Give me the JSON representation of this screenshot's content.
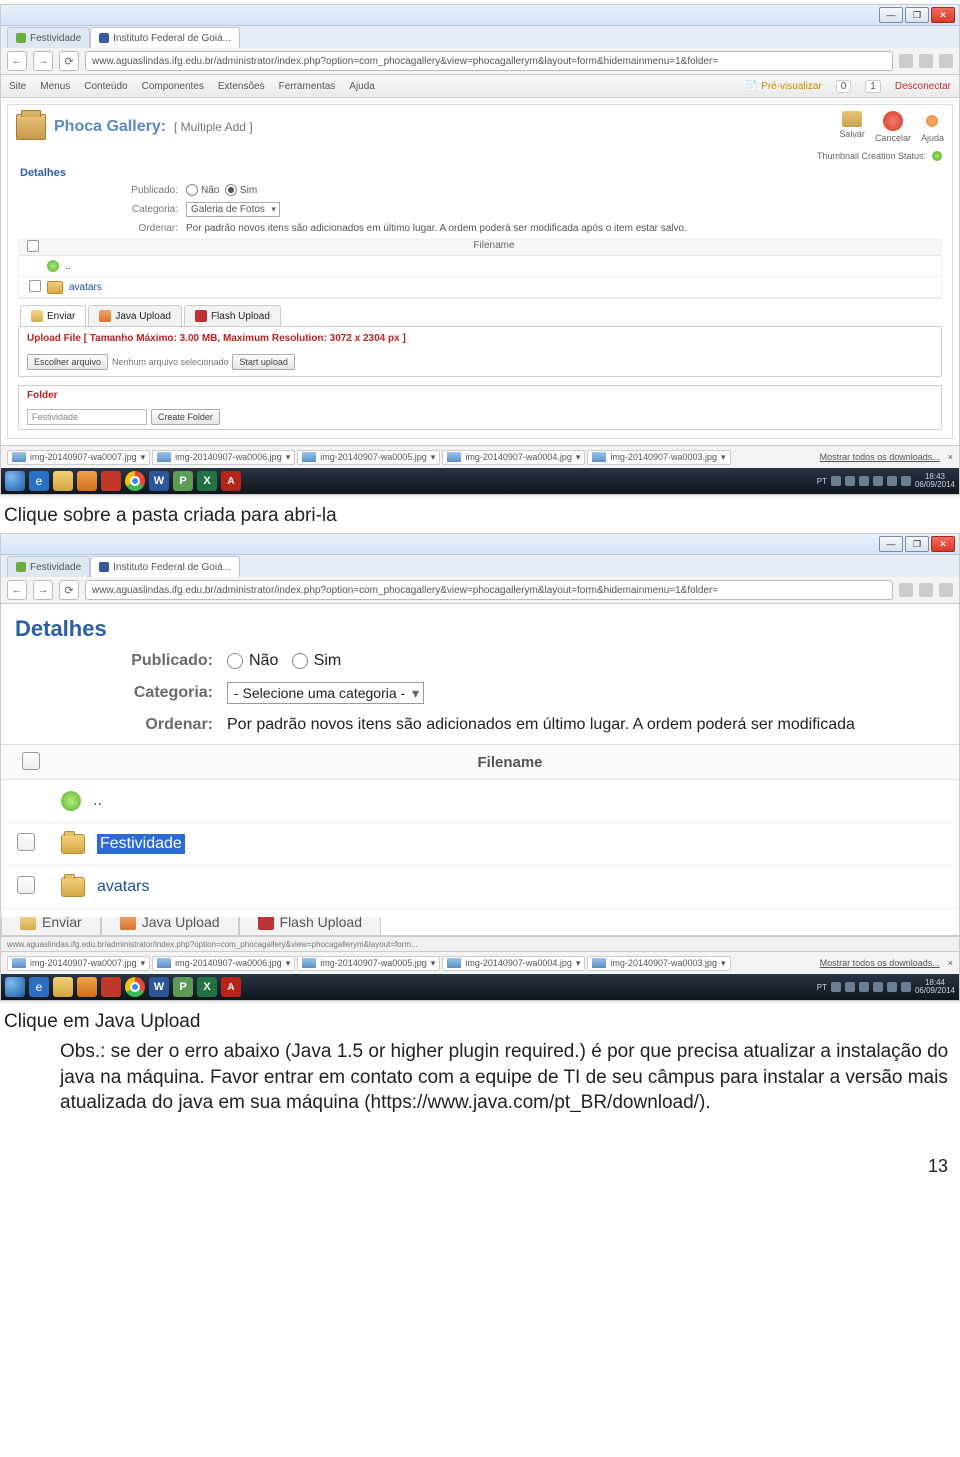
{
  "browser": {
    "tabs": [
      {
        "label": "Festividade"
      },
      {
        "label": "Instituto Federal de Goiá..."
      }
    ],
    "url": "www.aguaslindas.ifg.edu.br/administrator/index.php?option=com_phocagallery&view=phocagallerym&layout=form&hidemainmenu=1&folder=",
    "nav_back": "←",
    "nav_fwd": "→",
    "reload": "⟳"
  },
  "joomla_menu": {
    "items": [
      "Site",
      "Menus",
      "Conteúdo",
      "Componentes",
      "Extensões",
      "Ferramentas",
      "Ajuda"
    ],
    "preview": "Pré-visualizar",
    "badge0": "0",
    "badge1": "1",
    "disconnect": "Desconectar"
  },
  "phoca": {
    "name": "Phoca Gallery:",
    "subtitle": "[ Multiple Add ]",
    "actions": {
      "save": "Salvar",
      "cancel": "Cancelar",
      "help": "Ajuda"
    },
    "status_label": "Thumbnail Creation Status:"
  },
  "detalhes": {
    "legend": "Detalhes",
    "publicado_label": "Publicado:",
    "publicado_no": "Não",
    "publicado_yes": "Sim",
    "categoria_label": "Categoria:",
    "categoria_value_small": "Galeria de Fotos",
    "categoria_value_zoom": "- Selecione uma categoria -",
    "ordenar_label": "Ordenar:",
    "ordenar_text_small": "Por padrão novos itens são adicionados em último lugar. A ordem poderá ser modificada após o item estar salvo.",
    "ordenar_text_zoom": "Por padrão novos itens são adicionados em último lugar. A ordem poderá ser modificada"
  },
  "filetable": {
    "header": "Filename",
    "up": "..",
    "rows_small": [
      "avatars"
    ],
    "rows_zoom": [
      "Festividade",
      "avatars"
    ]
  },
  "uploadtabs": {
    "enviar": "Enviar",
    "java": "Java Upload",
    "flash": "Flash Upload"
  },
  "upload_box": {
    "title": "Upload File [ Tamanho Máximo: 3.00 MB, Maximum Resolution: 3072 x 2304 px ]",
    "choose": "Escolher arquivo",
    "none": "Nenhum arquivo selecionado",
    "start": "Start upload"
  },
  "folder_box": {
    "legend": "Folder",
    "placeholder": "Festividade",
    "create": "Create Folder"
  },
  "downloads": {
    "items": [
      "img-20140907-wa0007.jpg",
      "img-20140907-wa0006.jpg",
      "img-20140907-wa0005.jpg",
      "img-20140907-wa0004.jpg",
      "img-20140907-wa0003.jpg"
    ],
    "showall": "Mostrar todos os downloads...",
    "close": "×"
  },
  "taskbar": {
    "lang": "PT",
    "time1": "18:43",
    "time2": "18:44",
    "date": "06/09/2014",
    "word": "W",
    "pub": "P",
    "excel": "X",
    "pdf": "A"
  },
  "statusbar_zoom": "www.aguaslindas.ifg.edu.br/administrator/index.php?option=com_phocagallery&view=phocagallerym&layout=form...",
  "instructions": {
    "line1": "Clique sobre a pasta criada para abri-la",
    "line2": "Clique em Java Upload",
    "obs": "Obs.: se der o erro abaixo (Java 1.5 or higher plugin required.) é por que precisa atualizar a instalação do java na máquina. Favor entrar em contato com a equipe de TI de seu câmpus para instalar a versão mais atualizada do java em sua máquina (https://www.java.com/pt_BR/download/)."
  },
  "page_number": "13"
}
